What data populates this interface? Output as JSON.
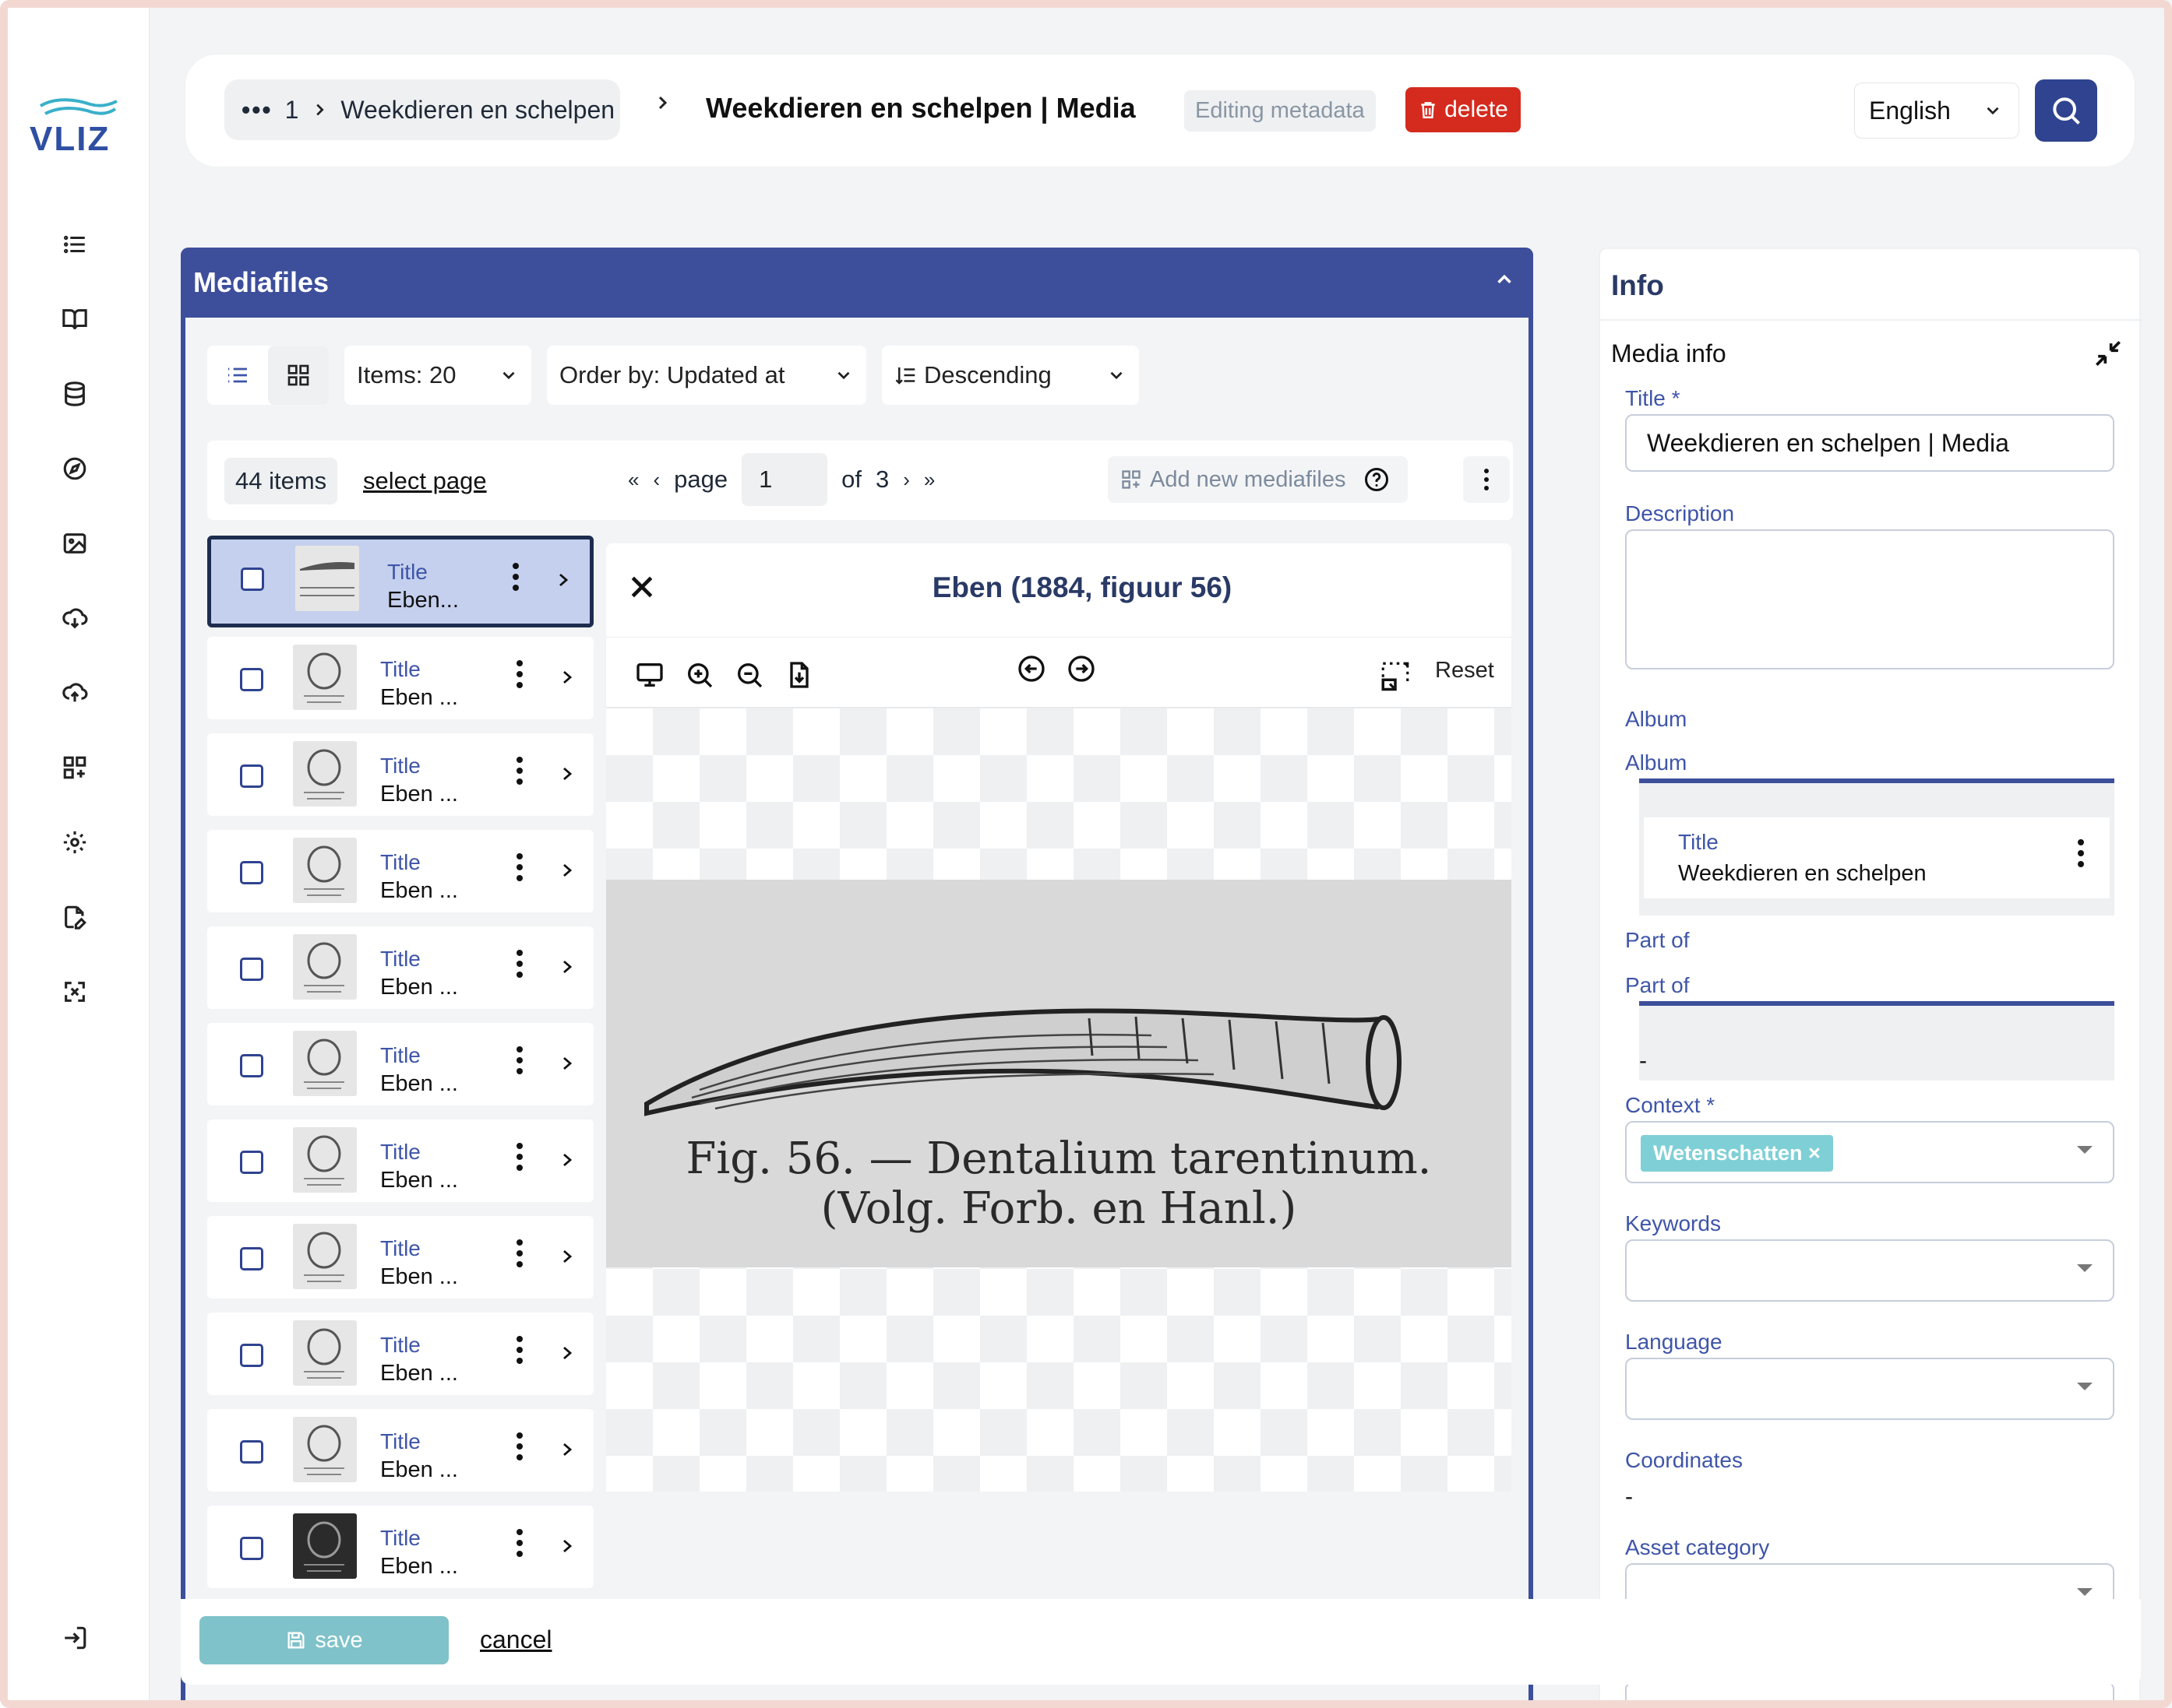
{
  "app": {
    "logo_text": "VLIZ"
  },
  "sidebar": {
    "items": [
      {
        "icon": "list-icon"
      },
      {
        "icon": "book-icon"
      },
      {
        "icon": "database-icon"
      },
      {
        "icon": "compass-icon"
      },
      {
        "icon": "image-icon"
      },
      {
        "icon": "cloud-download-icon"
      },
      {
        "icon": "cloud-upload-icon"
      },
      {
        "icon": "grid-plus-icon"
      },
      {
        "icon": "gear-icon"
      },
      {
        "icon": "document-edit-icon"
      },
      {
        "icon": "expand-icon"
      }
    ],
    "logout_icon": "logout-icon"
  },
  "header": {
    "breadcrumb_dots": "•••",
    "breadcrumb_index": "1",
    "breadcrumb_parent": "Weekdieren en schelpen",
    "title": "Weekdieren en schelpen | Media",
    "editing_badge": "Editing metadata",
    "delete_label": "delete",
    "language": "English"
  },
  "mediafiles": {
    "panel_title": "Mediafiles",
    "items_per_page": "Items: 20",
    "order_by": "Order by: Updated at",
    "direction": "Descending",
    "count_label": "44 items",
    "select_page_label": "select page",
    "page_label": "page",
    "page_value": "1",
    "of_label": "of",
    "total_pages": "3",
    "add_new_label": "Add new mediafiles",
    "list": [
      {
        "label": "Title",
        "value": "Eben..."
      },
      {
        "label": "Title",
        "value": "Eben ..."
      },
      {
        "label": "Title",
        "value": "Eben ..."
      },
      {
        "label": "Title",
        "value": "Eben ..."
      },
      {
        "label": "Title",
        "value": "Eben ..."
      },
      {
        "label": "Title",
        "value": "Eben ..."
      },
      {
        "label": "Title",
        "value": "Eben ..."
      },
      {
        "label": "Title",
        "value": "Eben ..."
      },
      {
        "label": "Title",
        "value": "Eben ..."
      },
      {
        "label": "Title",
        "value": "Eben ..."
      },
      {
        "label": "Title",
        "value": "Eben ..."
      }
    ]
  },
  "preview": {
    "title": "Eben (1884, figuur 56)",
    "reset_label": "Reset",
    "caption_line1": "Fig. 56. — Dentalium tarentinum.",
    "caption_line2": "(Volg. Forb. en Hanl.)"
  },
  "info": {
    "panel_title": "Info",
    "section_title": "Media info",
    "title_label": "Title *",
    "title_value": "Weekdieren en schelpen | Media",
    "description_label": "Description",
    "album_label": "Album",
    "album_sub_label": "Album",
    "album_card_label": "Title",
    "album_card_value": "Weekdieren en schelpen",
    "part_of_label": "Part of",
    "part_of_sub_label": "Part of",
    "part_of_value": "-",
    "context_label": "Context *",
    "context_chip": "Wetenschatten ×",
    "keywords_label": "Keywords",
    "language_label": "Language",
    "coordinates_label": "Coordinates",
    "coordinates_value": "-",
    "asset_category_label": "Asset category"
  },
  "footer": {
    "save_label": "save",
    "cancel_label": "cancel"
  },
  "colors": {
    "primary": "#3d4f9b",
    "delete": "#d42b1e",
    "save": "#7fc2c9",
    "chip": "#7fd0d6",
    "label_blue": "#3f55a8"
  }
}
